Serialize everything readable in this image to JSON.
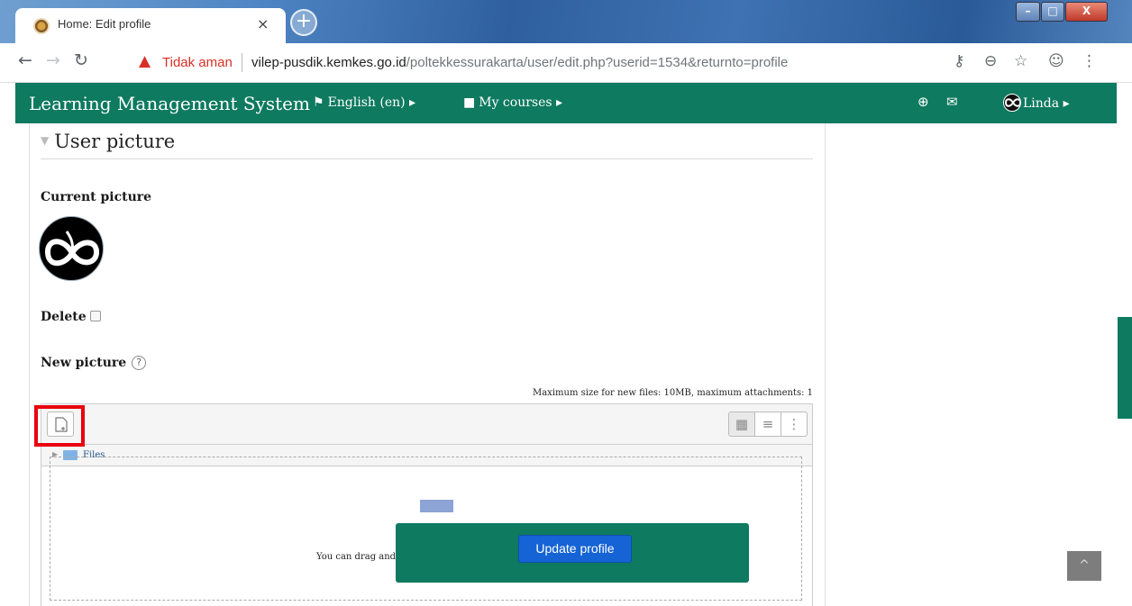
{
  "browser": {
    "tab_title": "Home: Edit profile",
    "tab_close": "×",
    "new_tab": "+",
    "security_label": "Tidak aman",
    "url_host": "vilep-pusdik.kemkes.go.id",
    "url_path": "/poltekkessurakarta/user/edit.php?userid=1534&returnto=profile",
    "window_buttons": {
      "minimize": "–",
      "maximize": "□",
      "close": "X"
    }
  },
  "navbar": {
    "brand": "Learning Management System",
    "language": "English (en)",
    "my_courses": "My courses",
    "user_name": "Linda",
    "accent_color": "#0e7a5f"
  },
  "section": {
    "title": "User picture",
    "current_picture_label": "Current picture",
    "delete_label": "Delete",
    "new_picture_label": "New picture",
    "max_size_text": "Maximum size for new files: 10MB, maximum attachments: 1"
  },
  "filepicker": {
    "path_label": "Files",
    "drop_text": "You can drag and"
  },
  "footer": {
    "update_button": "Update profile"
  },
  "icons": [
    "favicon-icon",
    "back-arrow-icon",
    "forward-arrow-icon",
    "reload-icon",
    "warning-icon",
    "key-icon",
    "zoom-icon",
    "star-icon",
    "profile-icon",
    "menu-dots-icon",
    "flag-icon",
    "briefcase-icon",
    "download-icon",
    "mail-icon",
    "add-file-icon",
    "grid-view-icon",
    "list-view-icon",
    "tree-view-icon",
    "folder-icon",
    "upload-icon",
    "chevron-up-icon"
  ]
}
